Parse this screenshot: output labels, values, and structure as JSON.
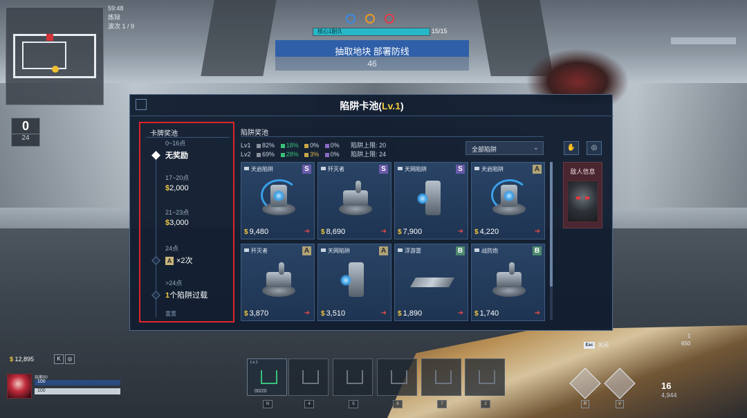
{
  "hud": {
    "timer": "59:48",
    "mode": "炼狱",
    "wave": "波次 1 / 9",
    "counter_big": "0",
    "counter_small": "24",
    "core_label": "核心1耐久",
    "core_count": "15/15",
    "core_fraction": 1.0,
    "objective_title": "抽取地块 部署防线",
    "objective_timer": "46",
    "money": "12,895",
    "player_name": "玩家00",
    "hp": "100",
    "armor": "100",
    "esc_key": "Esc",
    "esc_label": "关闭",
    "ammo_reserve_top": "1",
    "ammo_reserve_val": "650",
    "ammo_mag": "16",
    "ammo_total": "4,944",
    "slot_lv": "Lv.1",
    "slot_count": "00/20",
    "slot_keys": [
      "N",
      "4",
      "5",
      "6",
      "7",
      "2"
    ],
    "skill_keys": [
      "R",
      "V"
    ]
  },
  "modal": {
    "title_prefix": "陷阱卡池(",
    "title_level": "Lv.1",
    "title_suffix": ")",
    "reward_title": "卡牌奖池",
    "tiers": [
      {
        "range": "0~16点",
        "reward": "无奖励",
        "coin": false,
        "active": true
      },
      {
        "range": "17~20点",
        "reward": "2,000",
        "coin": true,
        "active": false
      },
      {
        "range": "21~23点",
        "reward": "3,000",
        "coin": true,
        "active": false
      },
      {
        "range": "24点",
        "reward": "×2次",
        "badge": "A",
        "active": false
      },
      {
        "range": ">24点",
        "reward": "个陷阱过载",
        "reward_prefix": "1",
        "active": false
      }
    ],
    "reset_label": "重置",
    "pool_title": "陷阱奖池",
    "prob_rows": [
      {
        "lv": "Lv1",
        "grey": "82%",
        "green": "18%",
        "yellow": "0%",
        "purple": "0%",
        "limit": "陷阱上限: 20"
      },
      {
        "lv": "Lv2",
        "grey": "69%",
        "green": "28%",
        "yellow": "3%",
        "purple": "0%",
        "limit": "陷阱上限: 24"
      }
    ],
    "filter_label": "全部陷阱",
    "enemy_info": "敌人信息",
    "cards": [
      {
        "name": "天启陷阱",
        "rank": "S",
        "price": "9,480",
        "art": "bow"
      },
      {
        "name": "歼灭者",
        "rank": "S",
        "price": "8,690",
        "art": "turret"
      },
      {
        "name": "天网陷阱",
        "rank": "S",
        "price": "7,900",
        "art": "pillar"
      },
      {
        "name": "天启陷阱",
        "rank": "A",
        "price": "4,220",
        "art": "bow"
      },
      {
        "name": "歼灭者",
        "rank": "A",
        "price": "3,870",
        "art": "turret"
      },
      {
        "name": "天网陷阱",
        "rank": "A",
        "price": "3,510",
        "art": "pillar"
      },
      {
        "name": "浮游雷",
        "rank": "B",
        "price": "1,890",
        "art": "flat"
      },
      {
        "name": "战防炮",
        "rank": "B",
        "price": "1,740",
        "art": "turret"
      }
    ]
  },
  "colors": {
    "accent": "#f2c940",
    "highlight_border": "#e0242a",
    "rank_S": "#6a5aa8",
    "rank_A": "#b0a276",
    "rank_B": "#4f8a6e"
  }
}
